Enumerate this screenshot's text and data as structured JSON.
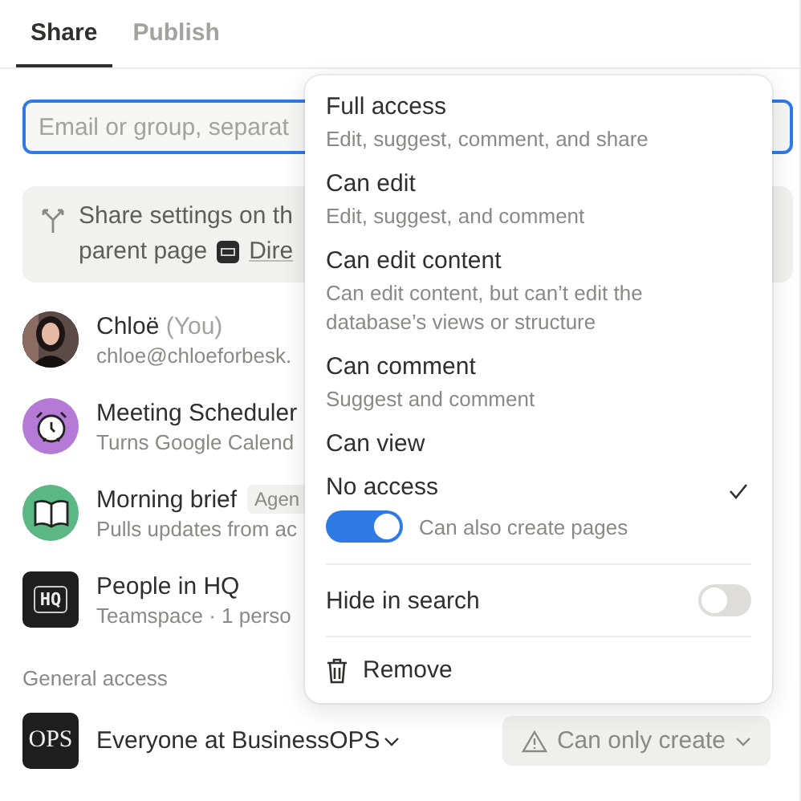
{
  "tabs": [
    {
      "label": "Share",
      "selected": true
    },
    {
      "label": "Publish",
      "selected": false
    }
  ],
  "invite": {
    "placeholder": "Email or group, separat"
  },
  "inherit_notice": {
    "text": "Share settings on th",
    "text_2": "parent page",
    "link": "Dire"
  },
  "members": [
    {
      "kind": "picture",
      "name": "Chloë",
      "suffix": "(You)",
      "detail": "chloe@chloeforbesk."
    },
    {
      "kind": "alarm-clock",
      "name": "Meeting Scheduler",
      "detail": "Turns Google Calend"
    },
    {
      "kind": "book",
      "name": "Morning brief",
      "badge": "Agen",
      "detail": "Pulls updates from ac"
    },
    {
      "kind": "logo",
      "avatar_text": "HQ",
      "name": "People in HQ",
      "detail": "Teamspace · 1 perso"
    }
  ],
  "general_access": {
    "label": "General access",
    "avatar_text": "OPS",
    "name": "Everyone at BusinessOPS",
    "access_button": "Can only create"
  },
  "menu": {
    "options": [
      {
        "title": "Full access",
        "description": "Edit, suggest, comment, and share",
        "selected": false
      },
      {
        "title": "Can edit",
        "description": "Edit, suggest, and comment",
        "selected": false
      },
      {
        "title": "Can edit content",
        "description": "Can edit content, but can’t edit the database’s views or structure",
        "selected": false
      },
      {
        "title": "Can comment",
        "description": "Suggest and comment",
        "selected": false
      },
      {
        "title": "Can view",
        "selected": false
      },
      {
        "title": "No access",
        "selected": true,
        "toggle": {
          "label": "Can also create pages",
          "on": true
        }
      }
    ],
    "hide_in_search": {
      "label": "Hide in search",
      "on": false
    },
    "remove": {
      "label": "Remove"
    }
  }
}
